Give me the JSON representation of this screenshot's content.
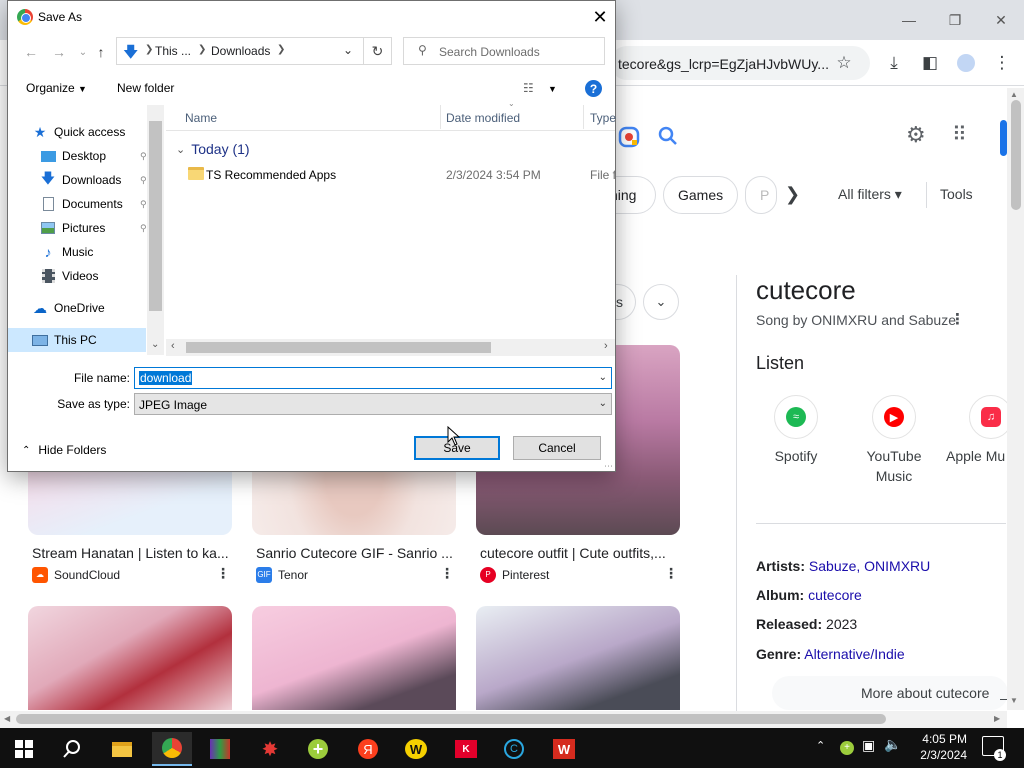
{
  "browser": {
    "omnibox_text": "tecore&gs_lcrp=EgZjaHJvbWUy...",
    "chips": [
      "ning",
      "Games",
      "P"
    ],
    "all_filters": "All filters",
    "tools": "Tools",
    "more_chip_fragment": "s"
  },
  "results": [
    {
      "title": "Stream Hanatan | Listen to ka...",
      "source": "SoundCloud",
      "fav_color": "#ff5500"
    },
    {
      "title": "Sanrio Cutecore GIF - Sanrio ...",
      "source": "Tenor",
      "fav_color": "#2b7de9"
    },
    {
      "title": "cutecore outfit | Cute outfits,...",
      "source": "Pinterest",
      "fav_color": "#e60023"
    }
  ],
  "fav_labels": {
    "tenor": "GIF"
  },
  "knowledge_panel": {
    "title": "cutecore",
    "subtitle": "Song by ONIMXRU and Sabuze",
    "listen": "Listen",
    "services": [
      {
        "label": "Spotify",
        "color": "#1db954"
      },
      {
        "label": "YouTube\nMusic",
        "color": "#ff0000"
      },
      {
        "label": "Apple Mu",
        "color": "#fa2d48"
      }
    ],
    "artists_label": "Artists:",
    "artists_value": "Sabuze, ONIMXRU",
    "album_label": "Album:",
    "album_value": "cutecore",
    "released_label": "Released:",
    "released_value": "2023",
    "genre_label": "Genre:",
    "genre_value": "Alternative/Indie",
    "more_about": "More about cutecore"
  },
  "dialog": {
    "title": "Save As",
    "breadcrumb_1": "This ...",
    "breadcrumb_2": "Downloads",
    "search_placeholder": "Search Downloads",
    "organize": "Organize",
    "new_folder": "New folder",
    "nav": {
      "quick_access": "Quick access",
      "desktop": "Desktop",
      "downloads": "Downloads",
      "documents": "Documents",
      "pictures": "Pictures",
      "music": "Music",
      "videos": "Videos",
      "onedrive": "OneDrive",
      "this_pc": "This PC"
    },
    "columns": {
      "name": "Name",
      "date": "Date modified",
      "type": "Type"
    },
    "group": "Today (1)",
    "row": {
      "name": "TS Recommended Apps",
      "date": "2/3/2024 3:54 PM",
      "type": "File fo"
    },
    "file_name_label": "File name:",
    "file_name_value": "download",
    "save_type_label": "Save as type:",
    "save_type_value": "JPEG Image",
    "hide_folders": "Hide Folders",
    "save": "Save",
    "cancel": "Cancel"
  },
  "taskbar": {
    "time": "4:05 PM",
    "date": "2/3/2024",
    "notification_count": "1"
  }
}
